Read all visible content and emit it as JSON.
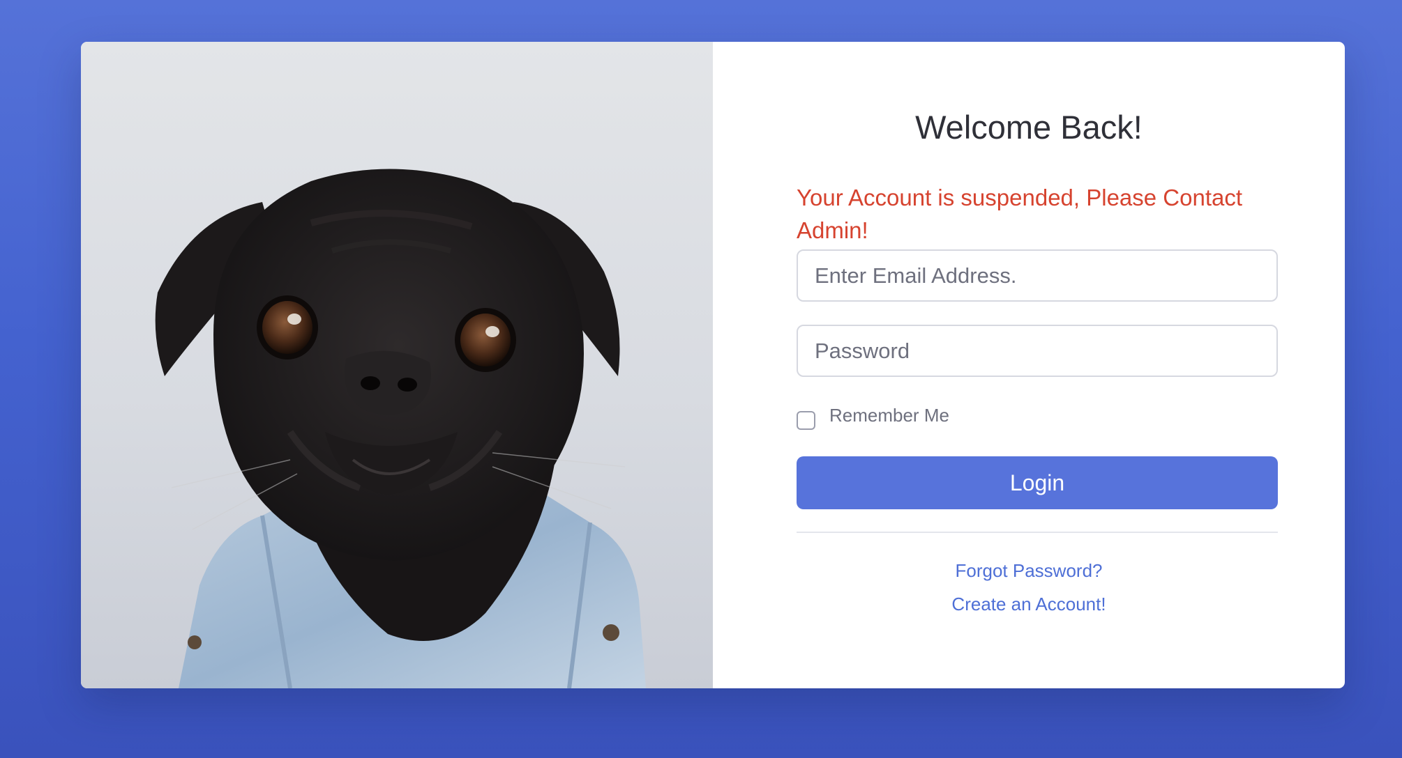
{
  "login": {
    "title": "Welcome Back!",
    "alert_message": "Your Account is suspended, Please Contact Admin!",
    "email_placeholder": "Enter Email Address.",
    "password_placeholder": "Password",
    "remember_label": "Remember Me",
    "remember_checked": false,
    "login_label": "Login",
    "forgot_password_link": "Forgot Password?",
    "create_account_link": "Create an Account!"
  },
  "colors": {
    "background": "#4b67d2",
    "primary": "#5773db",
    "alert": "#d6432f",
    "link": "#4e6fd6"
  }
}
